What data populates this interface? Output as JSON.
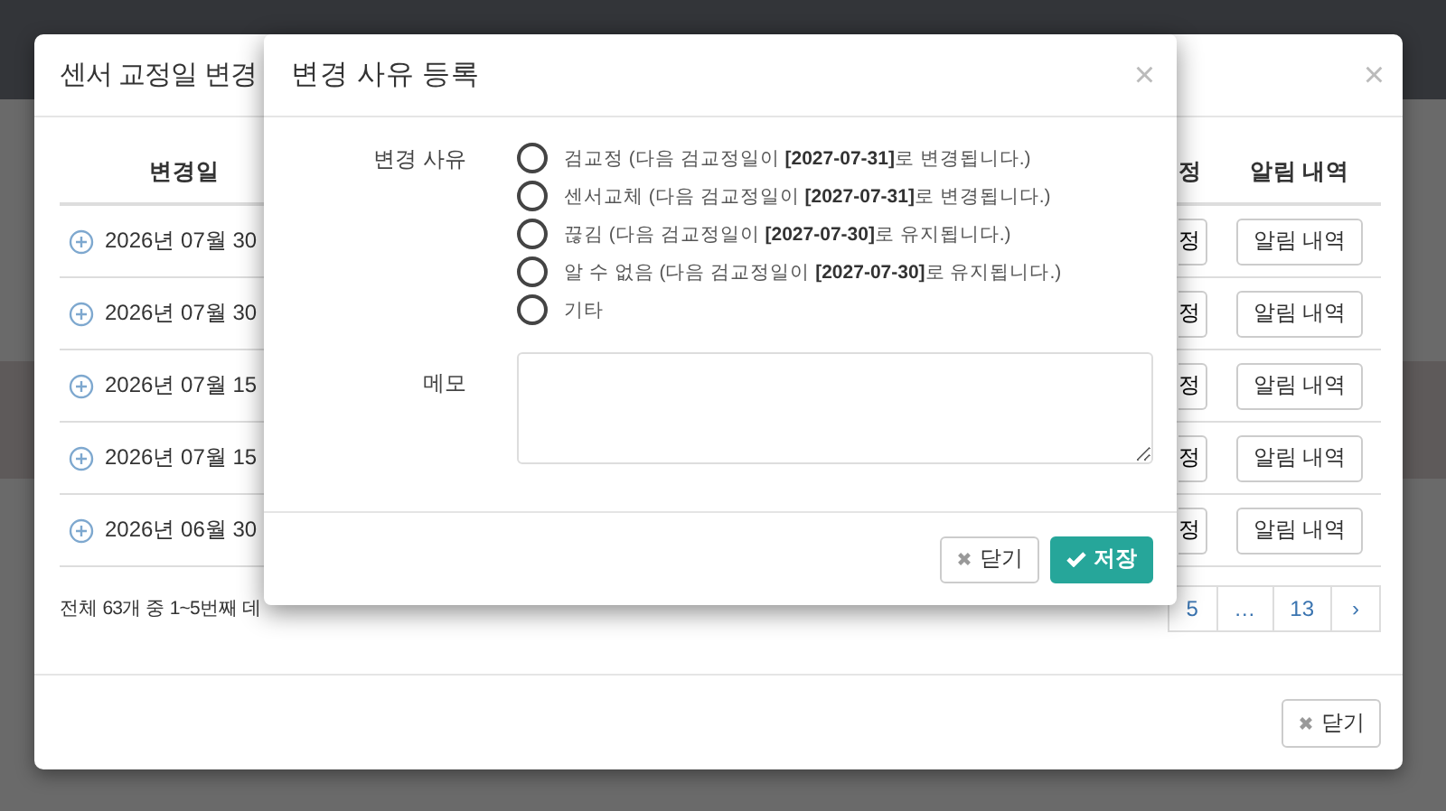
{
  "back_modal": {
    "title": "센서 교정일 변경",
    "close": "×",
    "columns": [
      "변경일",
      "정",
      "알림 내역"
    ],
    "rows": [
      {
        "date": "2026년 07월 30",
        "edit": "정",
        "history": "알림 내역"
      },
      {
        "date": "2026년 07월 30",
        "edit": "정",
        "history": "알림 내역"
      },
      {
        "date": "2026년 07월 15",
        "edit": "정",
        "history": "알림 내역"
      },
      {
        "date": "2026년 07월 15",
        "edit": "정",
        "history": "알림 내역"
      },
      {
        "date": "2026년 06월 30",
        "edit": "정",
        "history": "알림 내역"
      }
    ],
    "summary": "전체 63개 중 1~5번째 데",
    "pagination": [
      {
        "label": "5",
        "selected": false
      },
      {
        "label": "…",
        "selected": false
      },
      {
        "label": "13",
        "selected": false
      },
      {
        "label": "›",
        "selected": false
      }
    ],
    "close_button": "닫기"
  },
  "dialog": {
    "title": "변경 사유 등록",
    "close": "×",
    "reason_label": "변경 사유",
    "reasons": [
      {
        "label": "검교정 (다음 검교정일이 **[2027-07-31]**로 변경됩니다.)",
        "selected": false
      },
      {
        "label": "센서교체 (다음 검교정일이 **[2027-07-31]**로 변경됩니다.)",
        "selected": false
      },
      {
        "label": "끊김 (다음 검교정일이 **[2027-07-30]**로 유지됩니다.)",
        "selected": false
      },
      {
        "label": "알 수 없음 (다음 검교정일이 **[2027-07-30]**로 유지됩니다.)",
        "selected": false
      },
      {
        "label": "기타",
        "selected": false
      }
    ],
    "memo_label": "메모",
    "buttons": [
      {
        "kind": "close",
        "label": "닫기"
      },
      {
        "kind": "save",
        "label": "저장"
      }
    ]
  }
}
